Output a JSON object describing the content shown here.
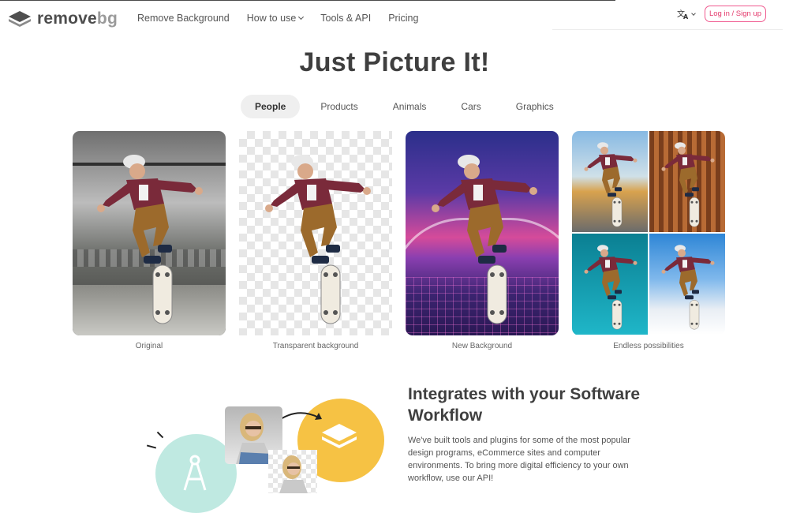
{
  "brand": {
    "name_main": "remove",
    "name_accent": "bg"
  },
  "nav": {
    "items": [
      {
        "label": "Remove Background",
        "dropdown": false
      },
      {
        "label": "How to use",
        "dropdown": true
      },
      {
        "label": "Tools & API",
        "dropdown": false
      },
      {
        "label": "Pricing",
        "dropdown": false
      }
    ],
    "language_icon": "translate-icon",
    "login_label": "Log in / Sign up"
  },
  "hero": {
    "title": "Just Picture It!",
    "tabs": [
      "People",
      "Products",
      "Animals",
      "Cars",
      "Graphics"
    ],
    "active_tab": "People"
  },
  "cards": [
    {
      "label": "Original"
    },
    {
      "label": "Transparent background"
    },
    {
      "label": "New Background"
    },
    {
      "label": "Endless possibilities"
    }
  ],
  "integrate": {
    "title": "Integrates with your Software Workflow",
    "body": "We've built tools and plugins for some of the most popular design programs, eCommerce sites and computer environments. To bring more digital efficiency to your own workflow, use our API!"
  },
  "colors": {
    "accent_pink": "#e43b6d",
    "text_dark": "#3f3f3f",
    "tab_active_bg": "#efefef",
    "teal_blob": "#bfe9e1",
    "yellow_blob": "#f6c244"
  }
}
